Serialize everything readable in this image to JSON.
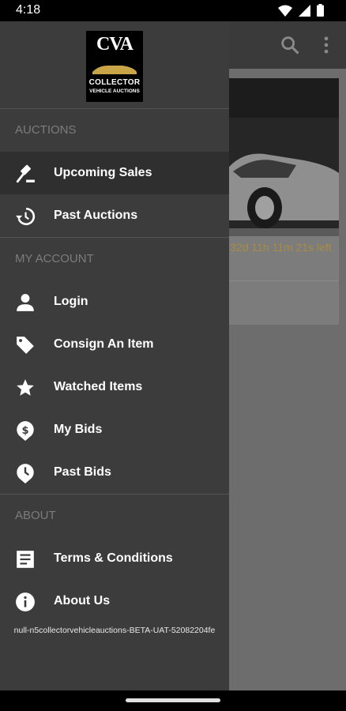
{
  "status_bar": {
    "time": "4:18"
  },
  "drawer": {
    "logo": {
      "top": "CVA",
      "line1": "COLLECTOR",
      "line2": "VEHICLE AUCTIONS"
    },
    "sections": {
      "auctions": {
        "title": "AUCTIONS",
        "items": [
          "Upcoming Sales",
          "Past Auctions"
        ]
      },
      "account": {
        "title": "MY ACCOUNT",
        "items": [
          "Login",
          "Consign An Item",
          "Watched Items",
          "My Bids",
          "Past Bids"
        ]
      },
      "about": {
        "title": "ABOUT",
        "items": [
          "Terms & Conditions",
          "About Us"
        ]
      }
    },
    "active_item": "Upcoming Sales",
    "build_id": "null-n5collectorvehicleauctions-BETA-UAT-52082204fe"
  },
  "background": {
    "card": {
      "time_left": "32d 11h 11m 21s left"
    },
    "toolbar_icons": [
      "search-icon",
      "more-vert-icon"
    ]
  },
  "colors": {
    "drawer_bg": "#3c3c3c",
    "active_bg": "#2f2f2f",
    "section_text": "#7c7c7c",
    "timer_text": "#a88c43"
  }
}
